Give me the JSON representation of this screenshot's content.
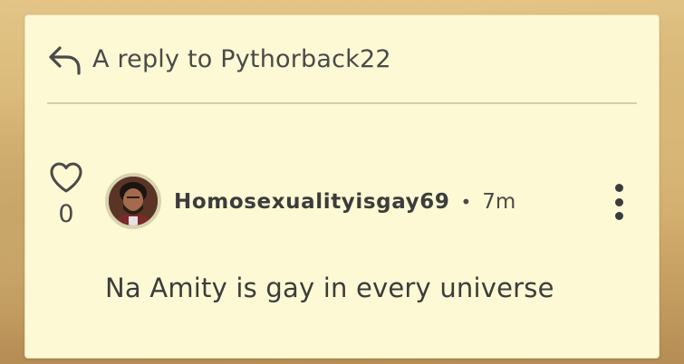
{
  "reply": {
    "icon": "reply-arrow-icon",
    "label": "A reply to Pythorback22"
  },
  "comment": {
    "likes": {
      "icon": "heart-icon",
      "count": "0"
    },
    "author": {
      "avatar": "avatar",
      "username": "Homosexualityisgay69"
    },
    "separator": "•",
    "time": "7m",
    "menu_icon": "more-vertical-icon",
    "text": "Na Amity is gay in every universe"
  },
  "colors": {
    "card_background": "#fdf9d4",
    "text": "#3c3c3c",
    "divider": "#d2cfb4"
  }
}
